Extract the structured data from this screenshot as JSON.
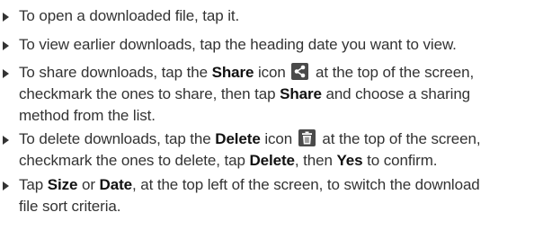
{
  "instructions": [
    {
      "text": "To open a downloaded file, tap it."
    },
    {
      "text": "To view earlier downloads, tap the heading date you want to view."
    },
    {
      "before": "To share downloads, tap the ",
      "bold1": "Share",
      "middle1": " icon",
      "icon": "share-icon",
      "after_icon": " at the top of the screen,",
      "line2_before": "checkmark the ones to share, then tap ",
      "bold2": "Share",
      "line2_after": " and choose a sharing",
      "line3": "method from the list."
    },
    {
      "before": "To delete downloads, tap the ",
      "bold1": "Delete",
      "middle1": " icon",
      "icon": "trash-icon",
      "after_icon": " at the top of the screen,",
      "line2_before": "checkmark the ones to delete, tap ",
      "bold2": "Delete",
      "line2_mid": ", then ",
      "bold3": "Yes",
      "line2_after": " to confirm."
    },
    {
      "before": "Tap ",
      "bold1": "Size",
      "middle1": " or ",
      "bold2": "Date",
      "after": ", at the top left of the screen, to switch the download",
      "line2": "file sort criteria."
    }
  ],
  "colors": {
    "text": "#333333",
    "icon_bg": "#4a4a4a"
  }
}
